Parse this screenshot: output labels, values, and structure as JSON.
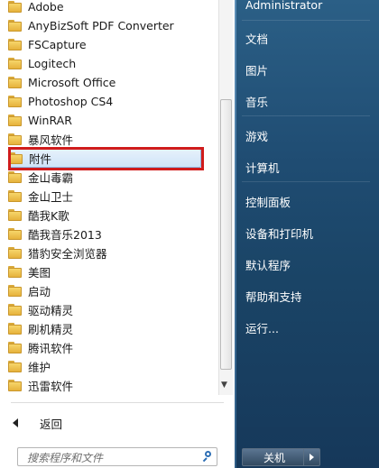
{
  "programs": [
    {
      "label": "Adobe"
    },
    {
      "label": "AnyBizSoft PDF Converter"
    },
    {
      "label": "FSCapture"
    },
    {
      "label": "Logitech"
    },
    {
      "label": "Microsoft Office"
    },
    {
      "label": "Photoshop CS4"
    },
    {
      "label": "WinRAR"
    },
    {
      "label": "暴风软件"
    },
    {
      "label": "附件"
    },
    {
      "label": "金山毒霸"
    },
    {
      "label": "金山卫士"
    },
    {
      "label": "酷我K歌"
    },
    {
      "label": "酷我音乐2013"
    },
    {
      "label": "猎豹安全浏览器"
    },
    {
      "label": "美图"
    },
    {
      "label": "启动"
    },
    {
      "label": "驱动精灵"
    },
    {
      "label": "刷机精灵"
    },
    {
      "label": "腾讯软件"
    },
    {
      "label": "维护"
    },
    {
      "label": "迅雷软件"
    }
  ],
  "back_label": "返回",
  "search": {
    "placeholder": "搜索程序和文件"
  },
  "right_menu": {
    "user": "Administrator",
    "items": [
      "文档",
      "图片",
      "音乐",
      "游戏",
      "计算机",
      "控制面板",
      "设备和打印机",
      "默认程序",
      "帮助和支持",
      "运行..."
    ]
  },
  "shutdown_label": "关机",
  "colors": {
    "highlight_border": "#d01c1c",
    "panel_blue": "#1f4c72"
  }
}
